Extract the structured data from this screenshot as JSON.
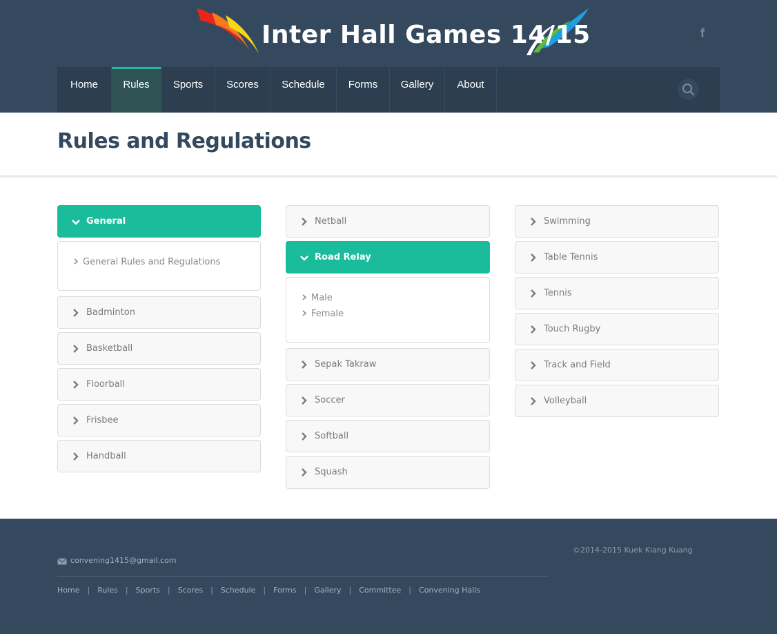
{
  "header": {
    "logo_text": "Inter Hall Games 14/15",
    "social_icon": "facebook-icon",
    "search_icon": "search-icon"
  },
  "nav": {
    "items": [
      "Home",
      "Rules",
      "Sports",
      "Scores",
      "Schedule",
      "Forms",
      "Gallery",
      "About"
    ],
    "active": "Rules"
  },
  "page": {
    "title": "Rules and Regulations"
  },
  "accordion": {
    "column1": [
      {
        "label": "General",
        "open": true,
        "links": [
          "General Rules and Regulations"
        ]
      },
      {
        "label": "Badminton"
      },
      {
        "label": "Basketball"
      },
      {
        "label": "Floorball"
      },
      {
        "label": "Frisbee"
      },
      {
        "label": "Handball"
      }
    ],
    "column2": [
      {
        "label": "Netball"
      },
      {
        "label": "Road Relay",
        "open": true,
        "links": [
          "Male",
          "Female"
        ]
      },
      {
        "label": "Sepak Takraw"
      },
      {
        "label": "Soccer"
      },
      {
        "label": "Softball"
      },
      {
        "label": "Squash"
      }
    ],
    "column3": [
      {
        "label": "Swimming"
      },
      {
        "label": "Table Tennis"
      },
      {
        "label": "Tennis"
      },
      {
        "label": "Touch Rugby"
      },
      {
        "label": "Track and Field"
      },
      {
        "label": "Volleyball"
      }
    ]
  },
  "footer": {
    "email": "convening1415@gmail.com",
    "copyright": "©2014-2015 Kuek Kiang Kuang",
    "links": [
      "Home",
      "Rules",
      "Sports",
      "Scores",
      "Schedule",
      "Forms",
      "Gallery",
      "Committee",
      "Convening Halls"
    ],
    "separator": "|"
  },
  "colors": {
    "header_bg": "#34495e",
    "nav_bg": "#2c3e50",
    "accent": "#1abc9c",
    "title": "#34495e"
  }
}
